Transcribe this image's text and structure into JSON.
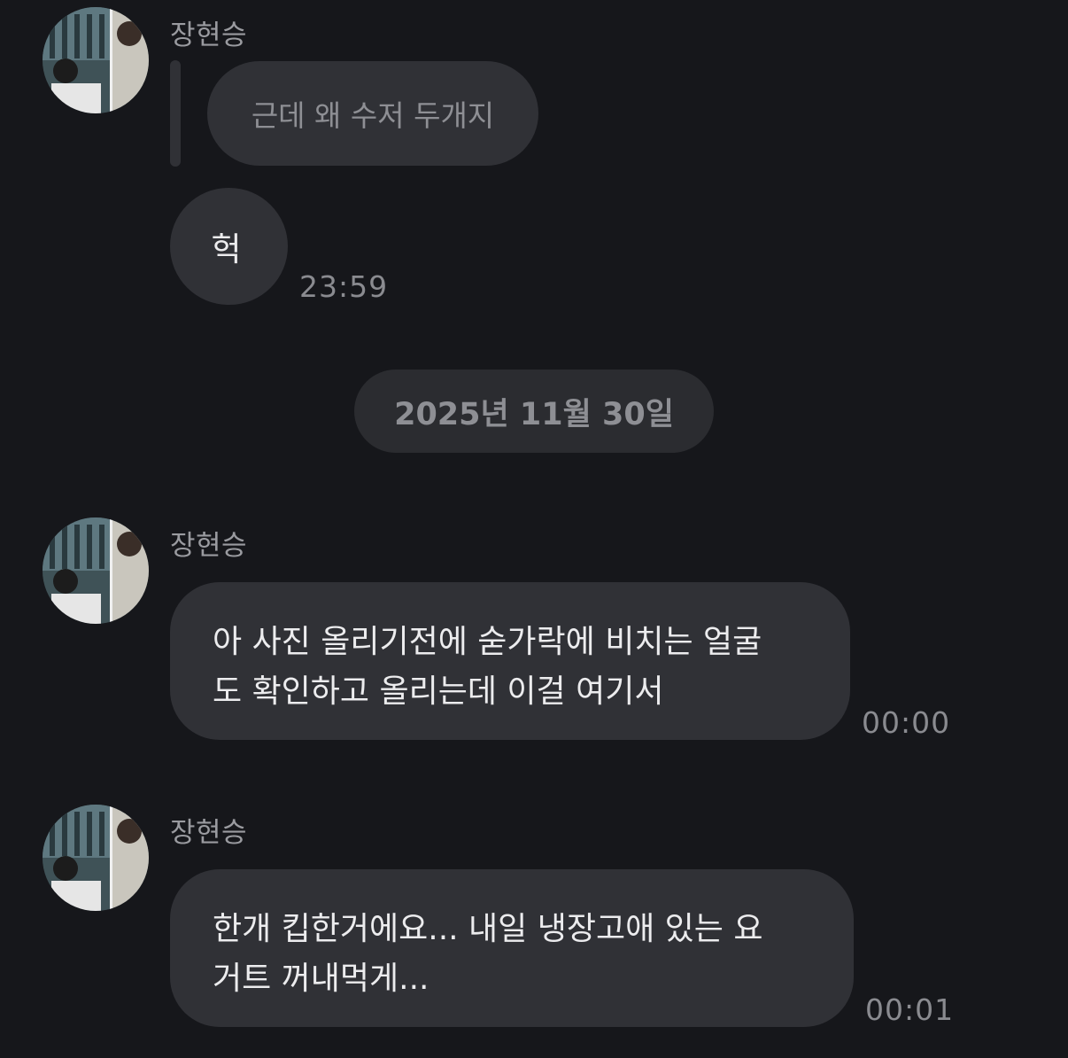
{
  "messages": [
    {
      "sender": "장현승",
      "reply_quote": "근데 왜 수저 두개지",
      "text": "헉",
      "time": "23:59"
    },
    {
      "sender": "장현승",
      "lines": [
        "아 사진 올리기전에 숟가락에 비치는 얼굴",
        "도 확인하고 올리는데 이걸 여기서"
      ],
      "time": "00:00"
    },
    {
      "sender": "장현승",
      "lines": [
        "한개 킵한거에요... 내일 냉장고애 있는 요",
        "거트 꺼내먹게..."
      ],
      "time": "00:01"
    }
  ],
  "date_divider": "2025년 11월 30일",
  "colors": {
    "background": "#16171b",
    "bubble": "#303136",
    "muted_text": "#8e8f94"
  }
}
